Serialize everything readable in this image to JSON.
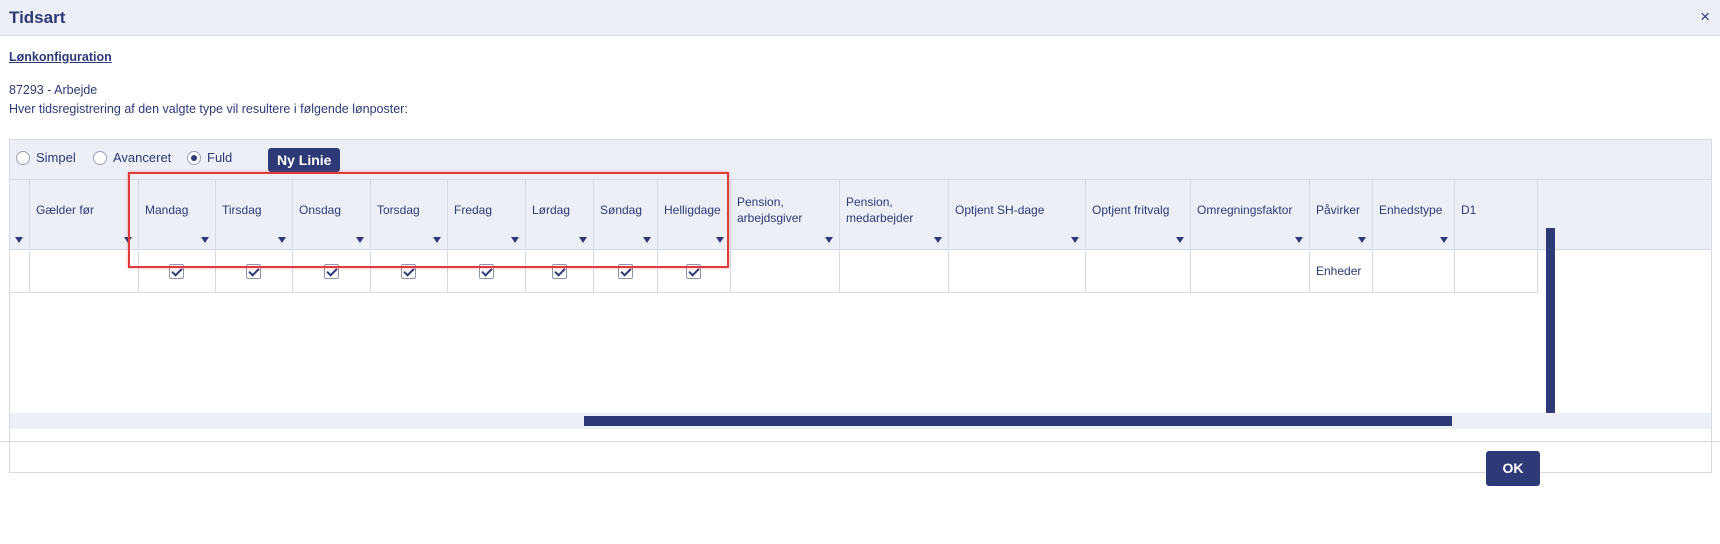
{
  "dialog": {
    "title": "Tidsart",
    "close_glyph": "×"
  },
  "section": {
    "link": "Lønkonfiguration",
    "code_line": "87293 - Arbejde",
    "description": "Hver tidsregistrering af den valgte type vil resultere i følgende lønposter:"
  },
  "toolbar": {
    "radios": [
      {
        "label": "Simpel",
        "selected": false
      },
      {
        "label": "Avanceret",
        "selected": false
      },
      {
        "label": "Fuld",
        "selected": true
      }
    ],
    "new_line_button": "Ny Linie"
  },
  "table": {
    "columns": [
      "",
      "Gælder før",
      "Mandag",
      "Tirsdag",
      "Onsdag",
      "Torsdag",
      "Fredag",
      "Lørdag",
      "Søndag",
      "Helligdage",
      "Pension, arbejdsgiver",
      "Pension, medarbejder",
      "Optjent SH-dage",
      "Optjent fritvalg",
      "Omregningsfaktor",
      "Påvirker",
      "Enhedstype",
      "D1"
    ],
    "rows": [
      {
        "gaelder_foer": "",
        "days_checked": [
          true,
          true,
          true,
          true,
          true,
          true,
          true,
          true
        ],
        "pension_arbejdsgiver": "",
        "pension_medarbejder": "",
        "optjent_sh_dage": "",
        "optjent_fritvalg": "",
        "omregningsfaktor": "",
        "paavirker": "Enheder",
        "enhedstype": "",
        "d1": ""
      }
    ]
  },
  "footer": {
    "ok_label": "OK"
  },
  "colors": {
    "accent": "#2e3a78",
    "header_bg": "#eceff6",
    "highlight": "#e03b3b"
  }
}
